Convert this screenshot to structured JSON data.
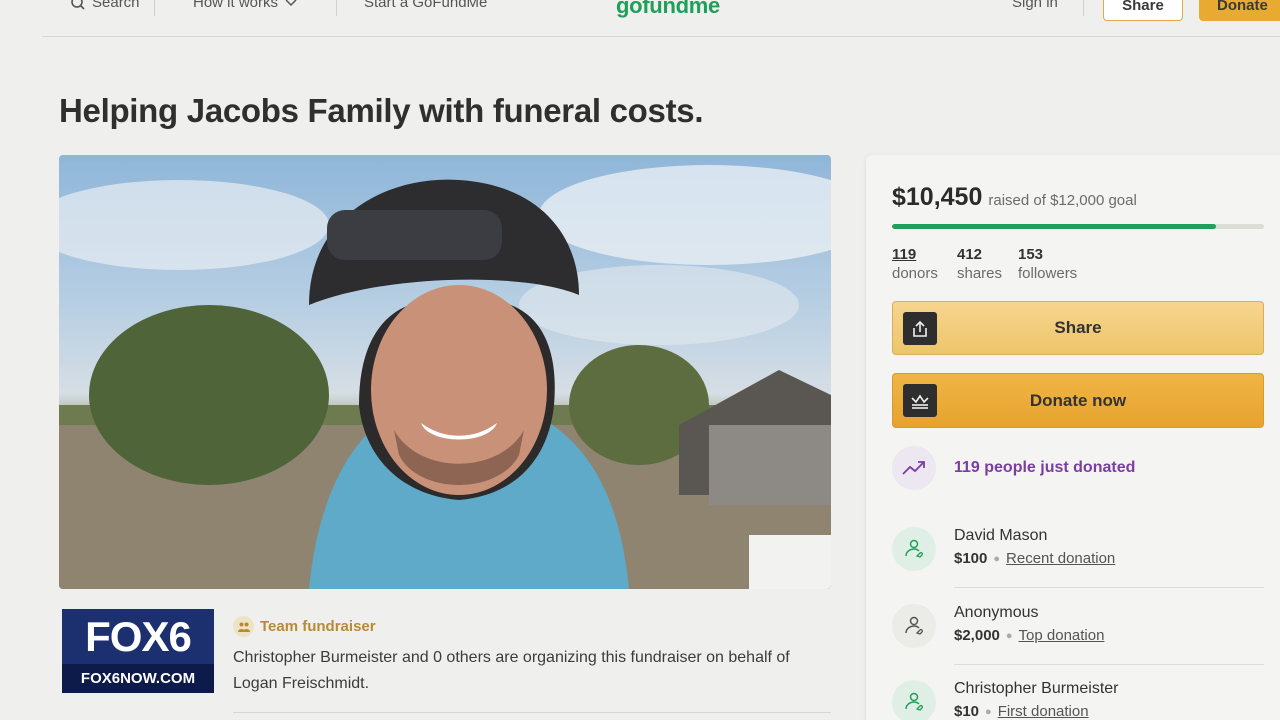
{
  "nav": {
    "search": "Search",
    "how_it_works": "How it works",
    "start": "Start a GoFundMe",
    "logo": "gofundme",
    "sign_in": "Sign in",
    "share": "Share",
    "donate": "Donate"
  },
  "campaign": {
    "title": "Helping Jacobs Family with funeral costs.",
    "raised": "$10,450",
    "goal_text": "raised of $12,000 goal",
    "progress_fraction": 0.871,
    "stats": [
      {
        "value": "119",
        "label": "donors"
      },
      {
        "value": "412",
        "label": "shares"
      },
      {
        "value": "153",
        "label": "followers"
      }
    ],
    "share_label": "Share",
    "donate_label": "Donate now",
    "trend_text": "119 people just donated"
  },
  "donations": [
    {
      "name": "David Mason",
      "amount": "$100",
      "tag": "Recent donation"
    },
    {
      "name": "Anonymous",
      "amount": "$2,000",
      "tag": "Top donation"
    },
    {
      "name": "Christopher Burmeister",
      "amount": "$10",
      "tag": "First donation"
    }
  ],
  "organizer": {
    "badge": "Team fundraiser",
    "text": "Christopher Burmeister and 0 others are organizing this fundraiser on behalf of Logan Freischmidt."
  },
  "overlay": {
    "logo_top": "FOX6",
    "logo_bottom": "FOX6NOW.COM"
  },
  "colors": {
    "brand_green": "#1fa05a",
    "donate_orange": "#e9aa32",
    "trend_purple": "#7b3ea0",
    "team_gold": "#b98a35"
  },
  "icons": [
    "search-icon",
    "chevron-down-icon",
    "share-upload-icon",
    "donate-crown-icon",
    "trending-up-icon",
    "donor-heart-icon",
    "team-icon"
  ]
}
